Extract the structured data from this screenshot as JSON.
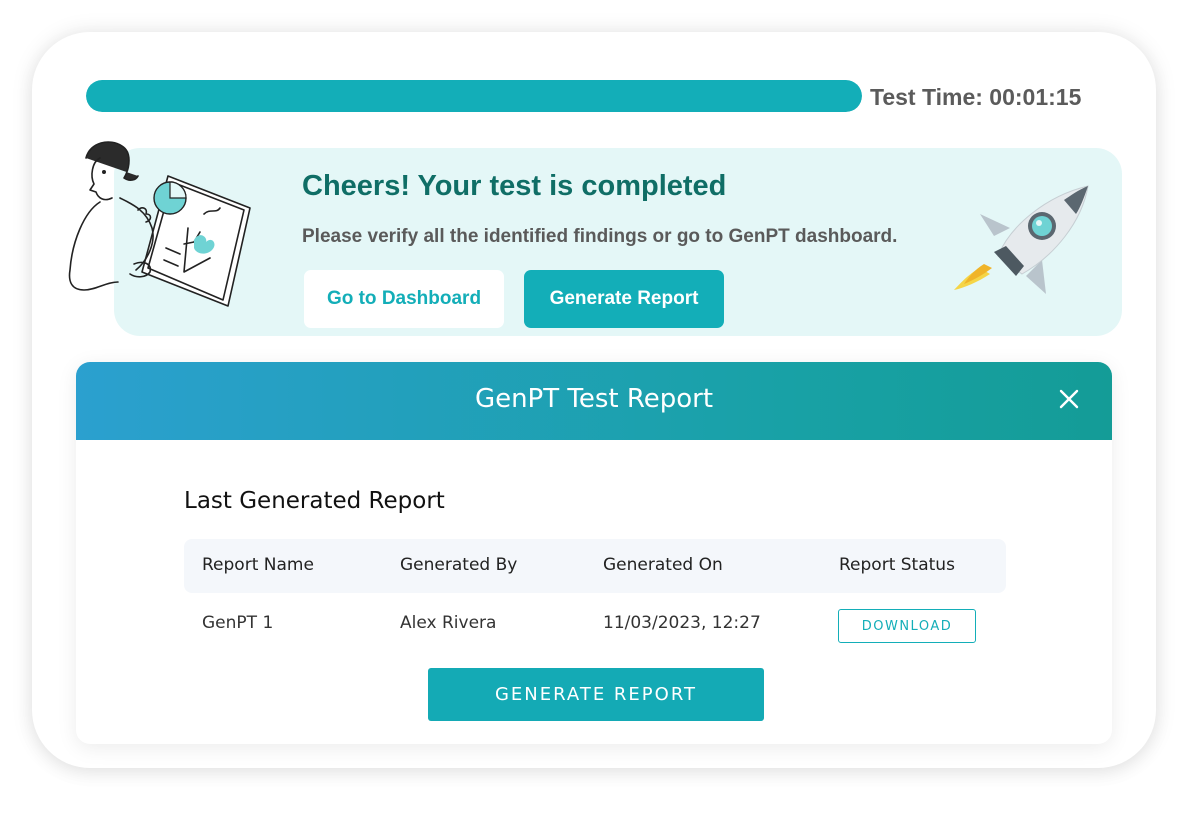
{
  "progress": {
    "percent": 100,
    "timer_label": "Test Time: 00:01:15"
  },
  "banner": {
    "title": "Cheers! Your test is completed",
    "subtitle": "Please verify all the identified findings or go to GenPT dashboard.",
    "dashboard_button": "Go to Dashboard",
    "generate_button": "Generate Report"
  },
  "modal": {
    "title": "GenPT Test Report",
    "section_title": "Last Generated Report",
    "table": {
      "headers": [
        "Report Name",
        "Generated By",
        "Generated On",
        "Report Status"
      ],
      "rows": [
        {
          "name": "GenPT 1",
          "by": "Alex Rivera",
          "on": "11/03/2023, 12:27",
          "status_button": "DOWNLOAD"
        }
      ]
    },
    "generate_button": "GENERATE REPORT"
  },
  "colors": {
    "accent": "#13aeb8",
    "banner_bg": "#e4f7f7",
    "title_green": "#0f6e66",
    "header_gradient_start": "#2ba0cf",
    "header_gradient_end": "#149c97"
  },
  "icons": {
    "illustration": "person-with-chart-illustration",
    "rocket": "rocket-icon",
    "close": "close-icon"
  }
}
